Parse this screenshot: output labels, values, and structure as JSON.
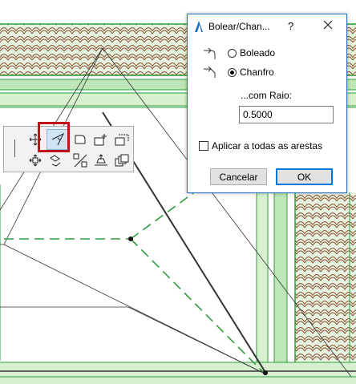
{
  "dialog": {
    "title": "Bolear/Chan...",
    "help_label": "?",
    "options": [
      {
        "label": "Boleado",
        "selected": false
      },
      {
        "label": "Chanfro",
        "selected": true
      }
    ],
    "radius_label": "...com Raio:",
    "radius_value": "0.5000",
    "apply_all_label": "Aplicar a todas as arestas",
    "apply_all_checked": false,
    "cancel_label": "Cancelar",
    "ok_label": "OK"
  },
  "pet_palette": {
    "tools": [
      {
        "name": "move-icon",
        "selected": false
      },
      {
        "name": "fillet-chamfer-icon",
        "selected": true
      },
      {
        "name": "rounded-corner-icon",
        "selected": false
      },
      {
        "name": "add-node-icon",
        "selected": false
      },
      {
        "name": "remove-node-icon",
        "selected": false
      },
      {
        "name": "drag-icon",
        "selected": false
      },
      {
        "name": "rotate-icon",
        "selected": false
      },
      {
        "name": "mirror-icon",
        "selected": false
      },
      {
        "name": "elevate-icon",
        "selected": false
      },
      {
        "name": "multiply-icon",
        "selected": false
      }
    ]
  },
  "colors": {
    "accent": "#0078d7",
    "highlight": "#c01318",
    "wall_green": "#2e9e3a",
    "roof_tile": "#8a4a2a"
  }
}
